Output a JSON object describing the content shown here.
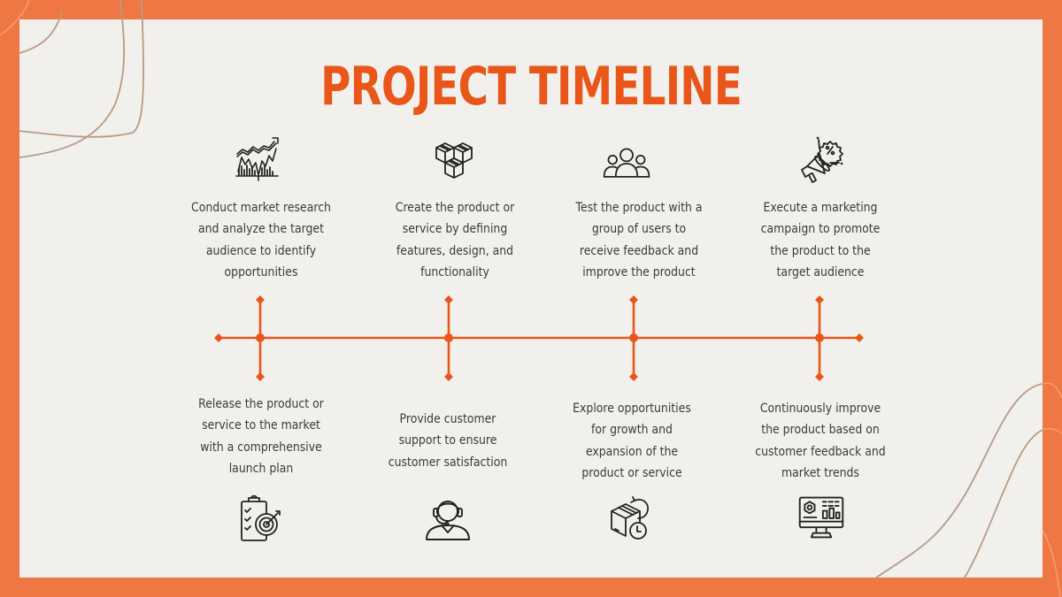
{
  "slide": {
    "title": "PROJECT TIMELINE",
    "colors": {
      "frame": "#ee7743",
      "background": "#f2f0ec",
      "accent": "#e8561a",
      "text": "#3b3b3b",
      "decor_lines": "#b89a85"
    }
  },
  "timeline": {
    "top_steps": [
      {
        "icon": "market-chart-icon",
        "text_lines": [
          "Conduct market research",
          "and analyze the target",
          "audience to identify",
          "opportunities"
        ]
      },
      {
        "icon": "boxes-icon",
        "text_lines": [
          "Create the product or",
          "service by defining",
          "features, design, and",
          "functionality"
        ]
      },
      {
        "icon": "user-group-icon",
        "text_lines": [
          "Test the product with a",
          "group of users to",
          "receive feedback and",
          "improve the product"
        ]
      },
      {
        "icon": "megaphone-discount-icon",
        "text_lines": [
          "Execute a marketing",
          "campaign to promote",
          "the product to the",
          "target audience"
        ]
      }
    ],
    "bottom_steps": [
      {
        "icon": "checklist-target-icon",
        "text_lines": [
          "Release the product or",
          "service to the market",
          "with a comprehensive",
          "launch plan"
        ]
      },
      {
        "icon": "customer-support-icon",
        "text_lines": [
          "Provide customer",
          "support to ensure",
          "customer satisfaction"
        ]
      },
      {
        "icon": "box-growth-clock-icon",
        "text_lines": [
          "Explore opportunities",
          "for growth and",
          "expansion of the",
          "product or service"
        ]
      },
      {
        "icon": "monitor-dashboard-icon",
        "text_lines": [
          "Continuously improve",
          "the product based on",
          "customer feedback and",
          "market trends"
        ]
      }
    ]
  }
}
